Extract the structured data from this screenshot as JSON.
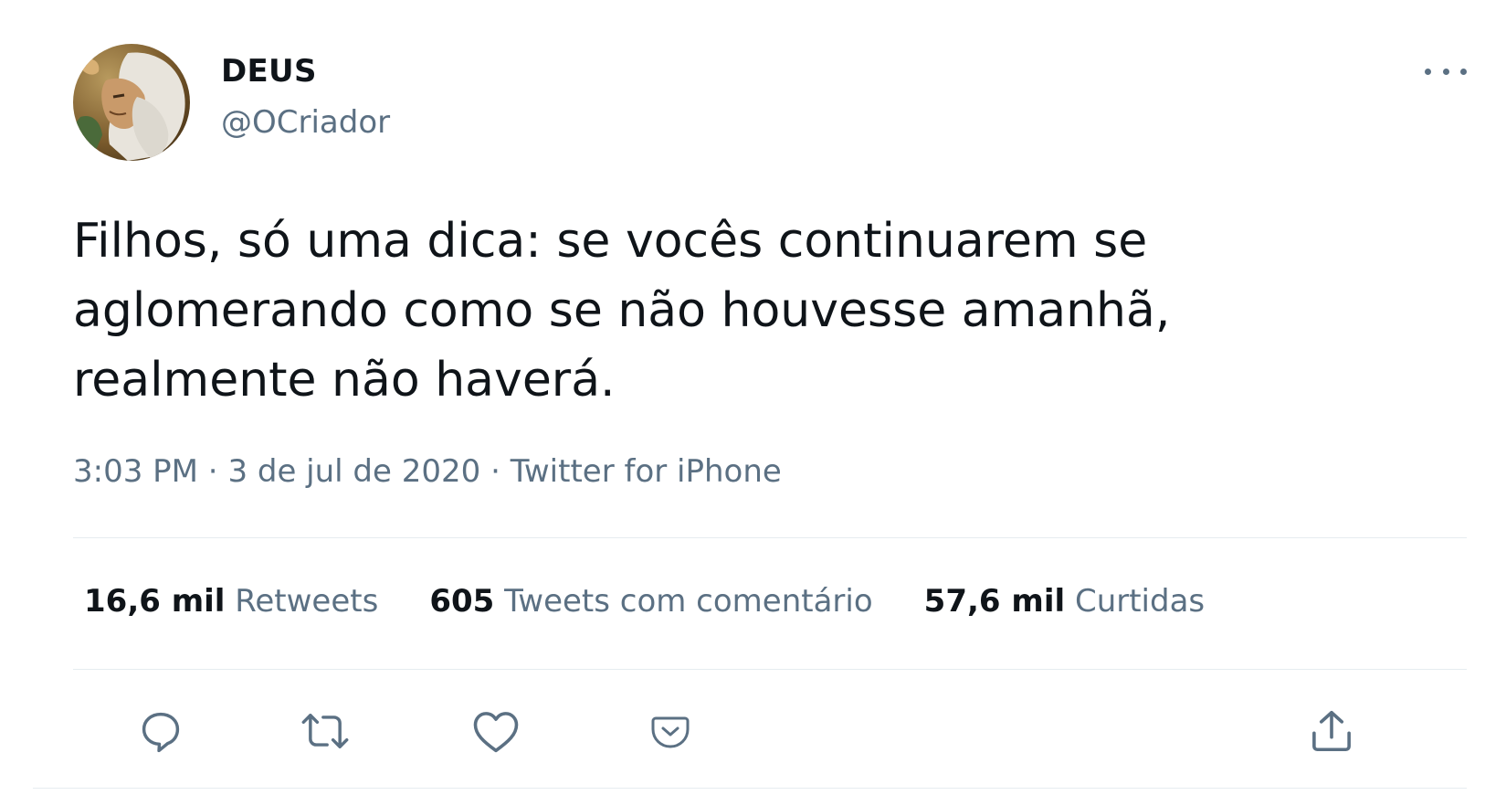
{
  "user": {
    "display_name": "DEUS",
    "handle": "@OCriador",
    "avatar_icon": "avatar-painting-icon"
  },
  "tweet": {
    "text": "Filhos, só uma dica: se vocês continuarem se aglomerando como se não houvesse amanhã, realmente não haverá.",
    "time": "3:03 PM",
    "separator": " · ",
    "date": "3 de jul de 2020",
    "source": "Twitter for iPhone"
  },
  "stats": {
    "retweets": {
      "count": "16,6 mil",
      "label": "Retweets"
    },
    "quotes": {
      "count": "605",
      "label": "Tweets com comentário"
    },
    "likes": {
      "count": "57,6 mil",
      "label": "Curtidas"
    }
  },
  "actions": {
    "reply_icon": "reply-icon",
    "retweet_icon": "retweet-icon",
    "like_icon": "heart-icon",
    "save_icon": "pocket-icon",
    "share_icon": "share-icon",
    "more_icon": "more-icon"
  },
  "colors": {
    "text_primary": "#0f1419",
    "text_secondary": "#5b7083",
    "divider": "#e6ecf0"
  }
}
